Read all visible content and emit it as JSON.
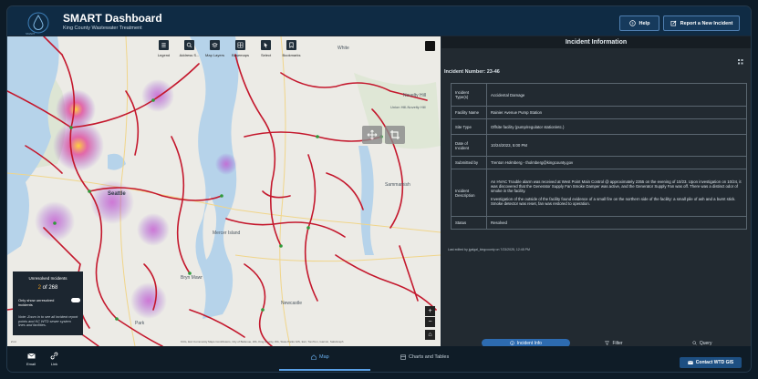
{
  "header": {
    "title": "SMART Dashboard",
    "subtitle": "King County Wastewater Treatment",
    "logo_text": "SMART",
    "help_label": "Help",
    "report_label": "Report a New Incident"
  },
  "map": {
    "toolbar": [
      {
        "label": "Legend",
        "icon": "list-icon"
      },
      {
        "label": "Address S...",
        "icon": "search-icon"
      },
      {
        "label": "Map Layers",
        "icon": "layers-icon"
      },
      {
        "label": "Basemaps",
        "icon": "grid-icon"
      },
      {
        "label": "Select",
        "icon": "cursor-icon"
      },
      {
        "label": "Bookmarks",
        "icon": "bookmark-icon"
      }
    ],
    "labels": {
      "white": "White",
      "novelty_hill": "Novelty Hill",
      "union_hill": "Union Hill-Novelty Hill",
      "seattle": "Seattle",
      "mercer_island": "Mercer Island",
      "newcastle": "Newcastle",
      "sammamish": "Sammamish",
      "bryn_mawr": "Bryn Mawr",
      "park": "Park"
    },
    "unresolved": {
      "title": "Unresolved Incidents",
      "current": "2",
      "of_text": "of 268",
      "toggle_label": "Only show unresolved incidents",
      "note": "Note: Zoom in to see all incident report points and KC WTD sewer system lines and facilities."
    },
    "attribution": "KCG, Esri Community Maps Contributors, City of Bellevue, WA, King County, WA, State Parks GIS, Esri, TomTom, Garmin, SafeGraph",
    "powered": "Powered by Esri",
    "scale": "2 mi"
  },
  "panel": {
    "title": "Incident Information",
    "incident_number": "Incident Number: 23-46",
    "rows": [
      {
        "key": "Incident Type(s)",
        "value": "Accidental Damage"
      },
      {
        "key": "Facility Name",
        "value": "Rainier Avenue Pump Station"
      },
      {
        "key": "Site Type",
        "value": "Offsite facility (pump/regulator station/etc.)"
      },
      {
        "key": "Date of Incident",
        "value": "10/24/2023, 5:00 PM"
      },
      {
        "key": "Submitted by",
        "value": "Trenton Holmberg - tholmberg@kingcounty.gov"
      },
      {
        "key": "Incident Description",
        "p1": "An HVAC Trouble alarm was received at West Point Main Control @ approximately 2355 on the evening of 10/23. Upon investigation on 10/24, it was discovered that the Generator Supply Fan Smoke Damper was active, and the Generator Supply Fan was off. There was a distinct odor of smoke in the facility.",
        "p2": "Investigation of the outside of the facility found evidence of a small fire on the northern side of the facility: a small pile of ash and a burnt stick. Smoke detector was reset, fan was restored to operation."
      },
      {
        "key": "Status",
        "value": "Resolved"
      }
    ],
    "updated": "Last edited by jgalgal_kingcounty on 7/23/2025, 12:45 PM",
    "tabs": [
      {
        "label": "Incident Info"
      },
      {
        "label": "Filter"
      },
      {
        "label": "Query"
      }
    ]
  },
  "footer": {
    "email": "Email",
    "link": "Link",
    "tab_map": "Map",
    "tab_charts": "Charts and Tables",
    "contact": "Contact WTD GIS"
  }
}
